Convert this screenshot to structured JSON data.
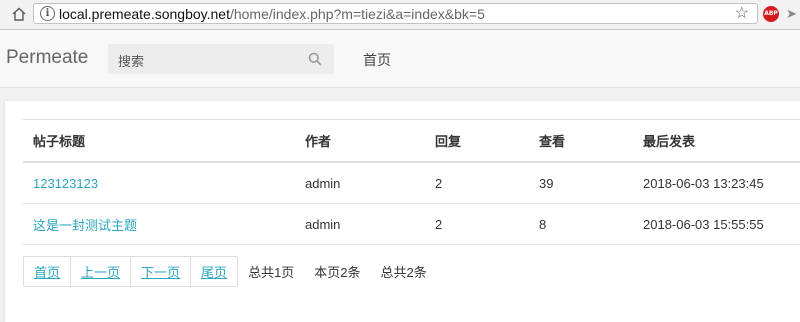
{
  "browser": {
    "url_host": "local.premeate.songboy.net",
    "url_path": "/home/index.php?m=tiezi&a=index&bk=5",
    "extension_label": "ABP"
  },
  "navbar": {
    "brand": "Permeate",
    "search_placeholder": "搜索",
    "home_link": "首页"
  },
  "table": {
    "headers": [
      "帖子标题",
      "作者",
      "回复",
      "查看",
      "最后发表"
    ],
    "rows": [
      {
        "title": "123123123",
        "author": "admin",
        "replies": "2",
        "views": "39",
        "last_post": "2018-06-03 13:23:45"
      },
      {
        "title": "这是一封测试主题",
        "author": "admin",
        "replies": "2",
        "views": "8",
        "last_post": "2018-06-03 15:55:55"
      }
    ]
  },
  "pagination": {
    "first": "首页",
    "prev": "上一页",
    "next": "下一页",
    "last": "尾页",
    "total_pages": "总共1页",
    "page_count": "本页2条",
    "total_count": "总共2条"
  },
  "colors": {
    "link": "#2aa6c0",
    "abp_badge": "#d6191f"
  },
  "icons": {
    "home": "home-icon",
    "info": "info-icon",
    "star": "star-icon",
    "search": "search-icon",
    "extension": "abp-icon"
  }
}
